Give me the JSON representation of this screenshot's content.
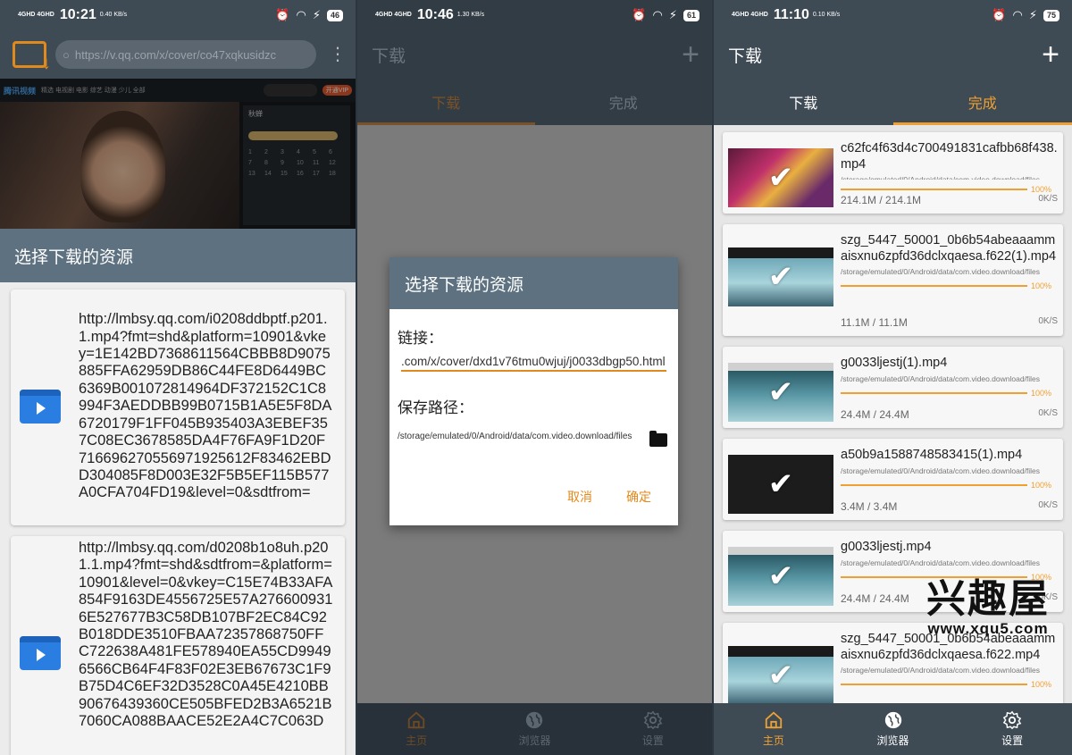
{
  "status1": {
    "net": "4GHD 4GHD",
    "time": "10:21",
    "speed": "0.40 KB/s",
    "battery": "46"
  },
  "status2": {
    "net": "4GHD 4GHD",
    "time": "10:46",
    "speed": "1.30 KB/s",
    "battery": "61"
  },
  "status3": {
    "net": "4GHD 4GHD",
    "time": "11:10",
    "speed": "0.10 KB/s",
    "battery": "75"
  },
  "browser": {
    "url": "https://v.qq.com/x/cover/co47xqkusidzc",
    "web": {
      "logo": "腾讯视频",
      "nav": "精选 电视剧 电影 综艺 动漫 少儿 全部",
      "open_btn": "开通VIP",
      "side_title": "秋蝉",
      "episodes": [
        "1",
        "2",
        "3",
        "4",
        "5",
        "6",
        "7",
        "8",
        "9",
        "10",
        "11",
        "12",
        "13",
        "14",
        "15",
        "16",
        "17",
        "18"
      ]
    }
  },
  "sheet": {
    "title": "选择下载的资源",
    "items": [
      "http://lmbsy.qq.com/i0208ddbptf.p201.1.mp4?fmt=shd&platform=10901&vkey=1E142BD7368611564CBBB8D9075885FFA62959DB86C44FE8D6449BC6369B001072814964DF372152C1C8994F3AEDDBB99B0715B1A5E5F8DA6720179F1FF045B935403A3EBEF357C08EC3678585DA4F76FA9F1D20F716696270556971925612F83462EBDD304085F8D003E32F5B5EF115B577A0CFA704FD19&level=0&sdtfrom=",
      "http://lmbsy.qq.com/d0208b1o8uh.p201.1.mp4?fmt=shd&sdtfrom=&platform=10901&level=0&vkey=C15E74B33AFA854F9163DE4556725E57A2766009316E527677B3C58DB107BF2EC84C92B018DDE3510FBAA72357868750FFC722638A481FE578940EA55CD99496566CB64F4F83F02E3EB67673C1F9B75D4C6EF32D3528C0A45E4210BB90676439360CE505BFED2B3A6521B7060CA088BAACE52E2A4C7C063D"
    ]
  },
  "app": {
    "title": "下载",
    "add": "+",
    "tab_download": "下载",
    "tab_done": "完成"
  },
  "dialog": {
    "title": "选择下载的资源",
    "link_label": "链接：",
    "link_value": ".com/x/cover/dxd1v76tmu0wjuj/j0033dbgp50.html",
    "path_label": "保存路径：",
    "path_value": "/storage/emulated/0/Android/data/com.video.download/files",
    "cancel": "取消",
    "ok": "确定"
  },
  "nav": {
    "home": "主页",
    "browser": "浏览器",
    "settings": "设置"
  },
  "downloads": [
    {
      "name": "c62fc4f63d4c700491831cafbb68f438.mp4",
      "path": "/storage/emulated/0/Android/data/com.video.download/files",
      "pct": "100%",
      "size": "214.1M / 214.1M",
      "speed": "0K/S",
      "thumb": "th1",
      "progress": 1.0
    },
    {
      "name": "szg_5447_50001_0b6b54abeaaammaisxnu6zpfd36dclxqaesa.f622(1).mp4",
      "path": "/storage/emulated/0/Android/data/com.video.download/files",
      "pct": "100%",
      "size": "11.1M / 11.1M",
      "speed": "0K/S",
      "thumb": "th2",
      "progress": 1.0
    },
    {
      "name": "g0033ljestj(1).mp4",
      "path": "/storage/emulated/0/Android/data/com.video.download/files",
      "pct": "100%",
      "size": "24.4M / 24.4M",
      "speed": "0K/S",
      "thumb": "th3",
      "progress": 1.0
    },
    {
      "name": "a50b9a1588748583415(1).mp4",
      "path": "/storage/emulated/0/Android/data/com.video.download/files",
      "pct": "100%",
      "size": "3.4M / 3.4M",
      "speed": "0K/S",
      "thumb": "th4",
      "progress": 1.0
    },
    {
      "name": "g0033ljestj.mp4",
      "path": "/storage/emulated/0/Android/data/com.video.download/files",
      "pct": "100%",
      "size": "24.4M / 24.4M",
      "speed": "0K/S",
      "thumb": "th3",
      "progress": 1.0
    },
    {
      "name": "szg_5447_50001_0b6b54abeaaammaisxnu6zpfd36dclxqaesa.f622.mp4",
      "path": "/storage/emulated/0/Android/data/com.video.download/files",
      "pct": "100%",
      "size": "",
      "speed": "",
      "thumb": "th2",
      "progress": 1.0
    }
  ],
  "watermark": {
    "cn": "兴趣屋",
    "url": "www.xqu5.com"
  },
  "colors": {
    "accent": "#f0a030",
    "toolbar": "#3e4a54",
    "dialog_header": "#5d7180",
    "icon_blue": "#2a7de1"
  }
}
